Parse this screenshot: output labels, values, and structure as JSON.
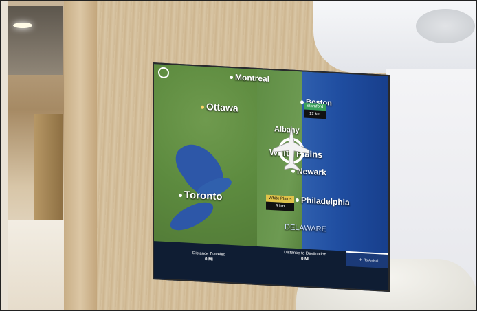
{
  "map": {
    "cities": {
      "montreal": "Montreal",
      "ottawa": "Ottawa",
      "boston": "Boston",
      "albany": "Albany",
      "white_plains": "White Plains",
      "newark": "Newark",
      "toronto": "Toronto",
      "philadelphia": "Philadelphia",
      "delaware": "DELAWARE"
    },
    "origin_tag": {
      "label": "Stamford",
      "distance": "12 km"
    },
    "position_tag": {
      "label": "White Plains",
      "distance": "3 km"
    }
  },
  "status_bar": {
    "distance_traveled_label": "Distance Traveled",
    "distance_traveled_value": "0",
    "distance_traveled_unit": "MI",
    "distance_destination_label": "Distance to Destination",
    "distance_destination_value": "0",
    "distance_destination_unit": "MI",
    "arrival_label": "To Arrival"
  },
  "colors": {
    "ocean": "#1f4da0",
    "land": "#5d8b3f",
    "bar": "#0f1d33",
    "tag_yellow": "#e0c34a",
    "tag_green": "#3aa05a"
  },
  "icons": [
    "compass-icon",
    "airplane-icon"
  ]
}
